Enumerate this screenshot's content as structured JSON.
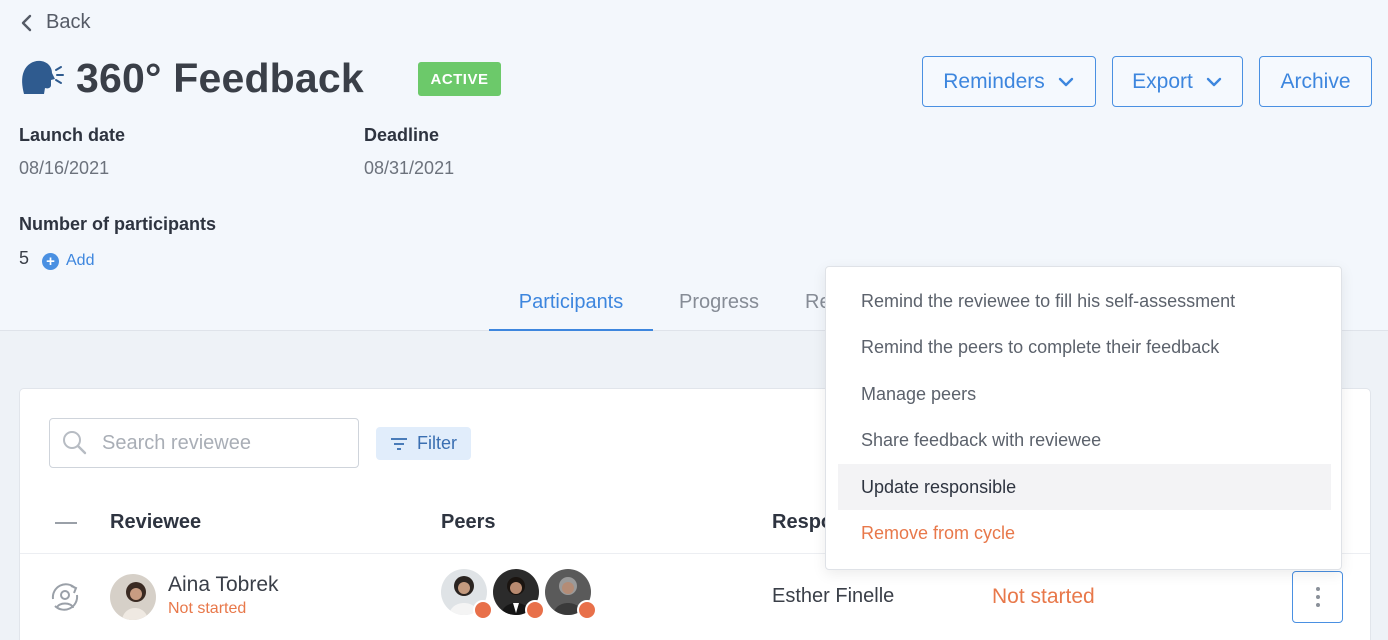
{
  "nav": {
    "back_label": "Back"
  },
  "header": {
    "title": "360° Feedback",
    "status_badge": "ACTIVE",
    "buttons": {
      "reminders": "Reminders",
      "export": "Export",
      "archive": "Archive"
    }
  },
  "meta": {
    "launch_date_label": "Launch date",
    "launch_date_value": "08/16/2021",
    "deadline_label": "Deadline",
    "deadline_value": "08/31/2021",
    "participants_label": "Number of participants",
    "participants_value": "5",
    "add_label": "Add"
  },
  "tabs": [
    {
      "label": "Participants",
      "active": true
    },
    {
      "label": "Progress",
      "active": false
    },
    {
      "label": "Re",
      "active": false
    }
  ],
  "toolbar": {
    "search_placeholder": "Search reviewee",
    "filter_label": "Filter"
  },
  "table": {
    "columns": {
      "reviewee": "Reviewee",
      "peers": "Peers",
      "responsible": "Respo"
    },
    "rows": [
      {
        "reviewee_name": "Aina Tobrek",
        "reviewee_status": "Not started",
        "responsible": "Esther Finelle",
        "status": "Not started"
      }
    ]
  },
  "menu": {
    "items": [
      "Remind the reviewee to fill his self-assessment",
      "Remind the peers to complete their feedback",
      "Manage peers",
      "Share feedback with reviewee",
      "Update responsible",
      "Remove from cycle"
    ]
  },
  "colors": {
    "accent": "#3d86de",
    "active_badge": "#6cc96a",
    "warning": "#e8784a",
    "header_bg": "#f3f7fc"
  },
  "icons": {
    "back": "chevron-left-icon",
    "title": "speaking-head-icon",
    "dropdown": "chevron-down-icon",
    "add": "plus-circle-icon",
    "search": "search-icon",
    "filter": "filter-icon",
    "row": "user-cycle-icon",
    "kebab": "more-vertical-icon"
  }
}
